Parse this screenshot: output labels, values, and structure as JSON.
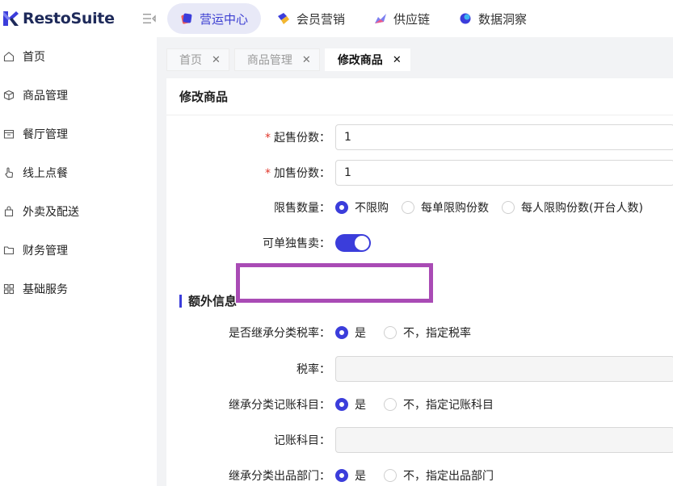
{
  "app": {
    "brand": "RestoSuite",
    "brand_color": "#1e2a5a",
    "accent": "#3b3ddb"
  },
  "top_nav": [
    {
      "label": "营运中心",
      "icon": "operations-icon",
      "active": true
    },
    {
      "label": "会员营销",
      "icon": "member-marketing-icon",
      "active": false
    },
    {
      "label": "供应链",
      "icon": "supply-chain-icon",
      "active": false
    },
    {
      "label": "数据洞察",
      "icon": "data-insight-icon",
      "active": false
    }
  ],
  "sidebar": {
    "items": [
      {
        "label": "首页",
        "icon": "home-icon"
      },
      {
        "label": "商品管理",
        "icon": "box-icon"
      },
      {
        "label": "餐厅管理",
        "icon": "store-icon"
      },
      {
        "label": "线上点餐",
        "icon": "hand-pointer-icon"
      },
      {
        "label": "外卖及配送",
        "icon": "bag-icon"
      },
      {
        "label": "财务管理",
        "icon": "folder-icon"
      },
      {
        "label": "基础服务",
        "icon": "grid-icon"
      }
    ]
  },
  "page_tabs": [
    {
      "label": "首页",
      "active": false
    },
    {
      "label": "商品管理",
      "active": false
    },
    {
      "label": "修改商品",
      "active": true
    }
  ],
  "page": {
    "title": "修改商品"
  },
  "form": {
    "min_sale": {
      "label": "起售份数",
      "value": "1",
      "required": true
    },
    "add_sale": {
      "label": "加售份数",
      "value": "1",
      "required": true
    },
    "limit_qty": {
      "label": "限售数量",
      "options": [
        "不限购",
        "每单限购份数",
        "每人限购份数(开台人数)"
      ],
      "selected": 0
    },
    "sell_alone": {
      "label": "可单独售卖",
      "on": true
    },
    "extra_section": "额外信息",
    "inherit_tax": {
      "label": "是否继承分类税率",
      "options": [
        "是",
        "不，指定税率"
      ],
      "selected": 0
    },
    "tax_rate": {
      "label": "税率",
      "value": ""
    },
    "inherit_account": {
      "label": "继承分类记账科目",
      "options": [
        "是",
        "不，指定记账科目"
      ],
      "selected": 0
    },
    "account": {
      "label": "记账科目",
      "value": ""
    },
    "inherit_dept": {
      "label": "继承分类出品部门",
      "options": [
        "是",
        "不，指定出品部门"
      ],
      "selected": 0
    }
  },
  "label_suffix": "："
}
